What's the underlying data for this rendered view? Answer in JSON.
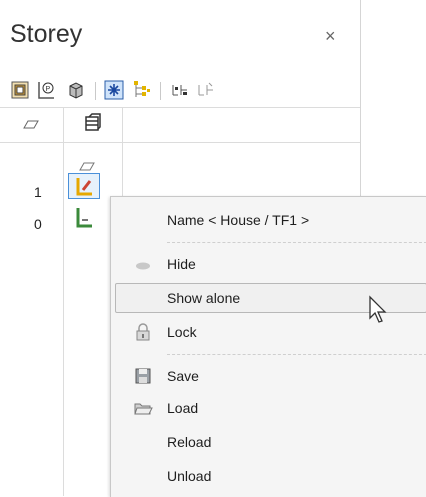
{
  "panel": {
    "title": "Storey",
    "close_glyph": "×"
  },
  "toolbar": {
    "icons": [
      "structure-icon",
      "parking-icon",
      "cube-icon",
      "snowflake-icon",
      "tree-icon",
      "storey-add-icon",
      "storey-remove-icon"
    ]
  },
  "grid": {
    "rows": [
      {
        "number": "1",
        "selected": true
      },
      {
        "number": "0",
        "selected": false
      }
    ]
  },
  "menu": {
    "header": "Name < House / TF1 >",
    "items": [
      {
        "label": "Hide",
        "icon": "cloud-icon"
      },
      {
        "label": "Show alone",
        "icon": ""
      },
      {
        "label": "Lock",
        "icon": "lock-icon"
      },
      {
        "label": "Save",
        "icon": "save-icon"
      },
      {
        "label": "Load",
        "icon": "folder-open-icon"
      },
      {
        "label": "Reload",
        "icon": ""
      },
      {
        "label": "Unload",
        "icon": ""
      }
    ]
  },
  "colors": {
    "accent": "#4a90d9",
    "highlight_border": "#b8b8b8",
    "menu_bg": "#f5f5f5"
  }
}
